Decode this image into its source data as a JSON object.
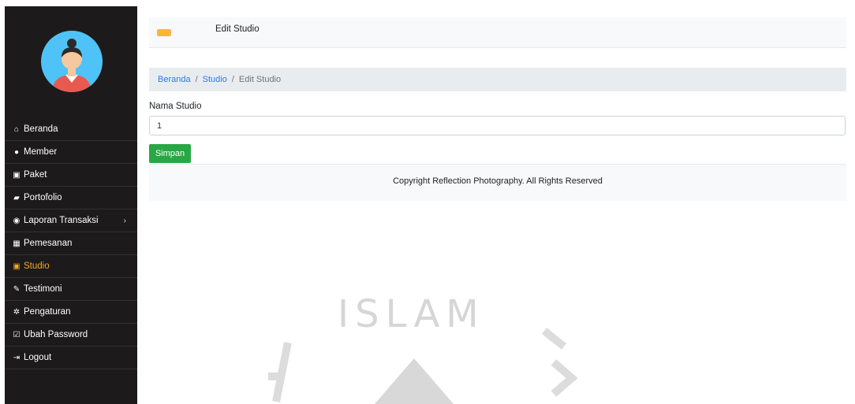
{
  "sidebar": {
    "items": [
      {
        "icon": "home-icon",
        "glyph": "⌂",
        "label": "Beranda"
      },
      {
        "icon": "user-icon",
        "glyph": "●",
        "label": "Member"
      },
      {
        "icon": "image-icon",
        "glyph": "▣",
        "label": "Paket"
      },
      {
        "icon": "book-icon",
        "glyph": "▰",
        "label": "Portofolio"
      },
      {
        "icon": "globe-icon",
        "glyph": "◉",
        "label": "Laporan Transaksi"
      },
      {
        "icon": "calendar-icon",
        "glyph": "▦",
        "label": "Pemesanan"
      },
      {
        "icon": "studio-icon",
        "glyph": "▣",
        "label": "Studio"
      },
      {
        "icon": "pencil-icon",
        "glyph": "✎",
        "label": "Testimoni"
      },
      {
        "icon": "gear-icon",
        "glyph": "✲",
        "label": "Pengaturan"
      },
      {
        "icon": "edit-icon",
        "glyph": "☑",
        "label": "Ubah Password"
      },
      {
        "icon": "logout-icon",
        "glyph": "⇥",
        "label": "Logout"
      }
    ],
    "active_label": "Studio",
    "active_color": "#f7a823"
  },
  "header": {
    "title": "Edit Studio"
  },
  "breadcrumb": {
    "home": "Beranda",
    "separator": "/",
    "section": "Studio",
    "current": "Edit Studio"
  },
  "form": {
    "label": "Nama Studio",
    "value": "1",
    "submit_label": "Simpan"
  },
  "footer": {
    "text": "Copyright Reflection Photography. All Rights Reserved"
  },
  "watermark": {
    "text": "ISLAM"
  },
  "colors": {
    "sidebar_bg": "#1c1a1a",
    "accent": "#f7b731",
    "button": "#28a745",
    "link": "#2a7ae4"
  }
}
